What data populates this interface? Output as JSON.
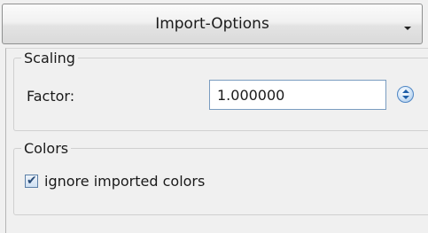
{
  "header": {
    "title": "Import-Options",
    "arrow_icon": "triangle-down-icon"
  },
  "scaling": {
    "group_label": "Scaling",
    "factor_label": "Factor:",
    "factor_value": "1.000000",
    "spin_icon": "spin-updown-icon"
  },
  "colors": {
    "group_label": "Colors",
    "ignore_imported_label": "ignore imported colors",
    "ignore_imported_checked": true
  },
  "theme": {
    "accent": "#4f86c4",
    "background": "#f0f0f0"
  }
}
